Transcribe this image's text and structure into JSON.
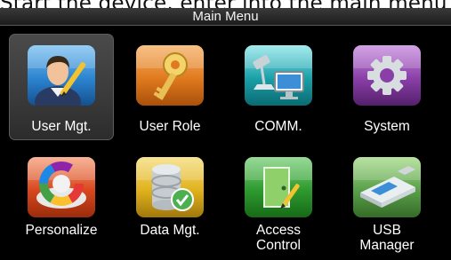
{
  "caption": "Start the device, enter into the main menu",
  "window": {
    "title": "Main Menu"
  },
  "menu": {
    "selected_index": 0,
    "items": [
      {
        "label": "User Mgt.",
        "icon": "user-edit-icon",
        "color": "#1f78c8"
      },
      {
        "label": "User Role",
        "icon": "key-icon",
        "color": "#e07a1e"
      },
      {
        "label": "COMM.",
        "icon": "network-icon",
        "color": "#1aa0a8"
      },
      {
        "label": "System",
        "icon": "gear-icon",
        "color": "#8a3fa8"
      },
      {
        "label": "Personalize",
        "icon": "color-wheel-icon",
        "color": "#d8481e"
      },
      {
        "label": "Data Mgt.",
        "icon": "database-check-icon",
        "color": "#e0b21e"
      },
      {
        "label": "Access\nControl",
        "icon": "door-icon",
        "color": "#2e9a2e"
      },
      {
        "label": "USB\nManager",
        "icon": "usb-drive-icon",
        "color": "#5aa04a"
      }
    ]
  }
}
